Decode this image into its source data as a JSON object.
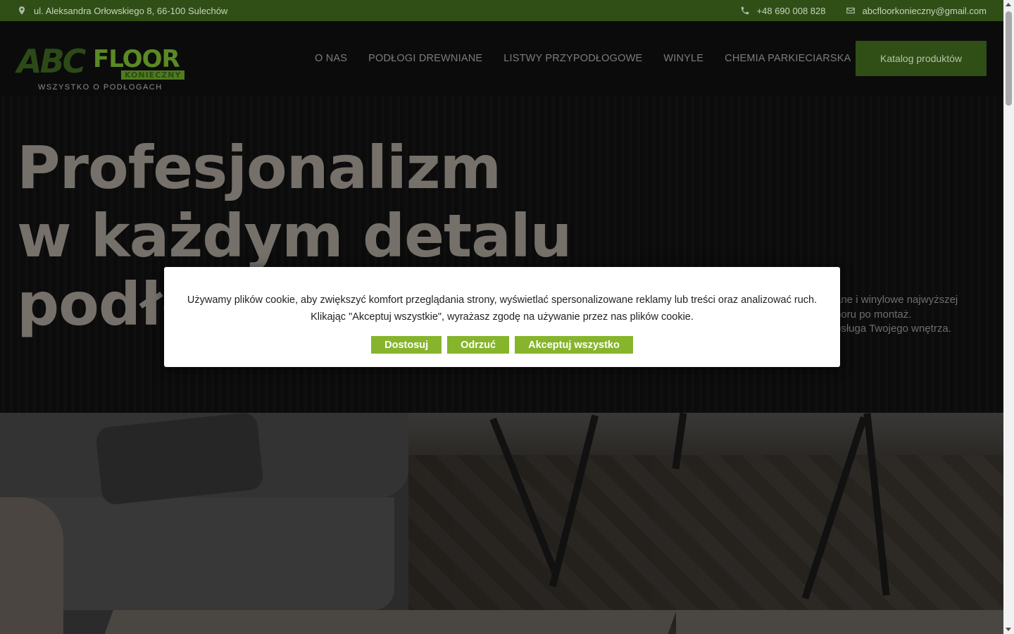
{
  "topbar": {
    "address": "ul. Aleksandra Orłowskiego 8, 66-100 Sulechów",
    "phone": "+48 690 008 828",
    "email": "abcfloorkonieczny@gmail.com",
    "icons": [
      "location-pin-icon",
      "phone-icon",
      "envelope-icon"
    ]
  },
  "header": {
    "logo": {
      "abc": "ABC",
      "floor": "FLOOR",
      "konieczny": "KONIECZNY",
      "tagline": "WSZYSTKO O PODŁOGACH"
    },
    "nav": [
      {
        "label": "O NAS"
      },
      {
        "label": "PODŁOGI DREWNIANE"
      },
      {
        "label": "LISTWY PRZYPODŁOGOWE"
      },
      {
        "label": "WINYLE"
      },
      {
        "label": "CHEMIA PARKIECIARSKA"
      }
    ],
    "cta_label": "Katalog produktów"
  },
  "hero": {
    "title_lines": [
      "Profesjonalizm",
      "w każdym detalu",
      "podło"
    ],
    "description_lines": [
      "ane i winylowe najwyższej",
      "boru po montaż.",
      "bsługa Twojego wnętrza."
    ]
  },
  "cookie": {
    "text_line1": "Używamy plików cookie, aby zwiększyć komfort przeglądania strony, wyświetlać spersonalizowane reklamy lub treści oraz analizować ruch.",
    "text_line2": "Klikając \"Akceptuj wszystkie\", wyrażasz zgodę na używanie przez nas plików cookie.",
    "buttons": {
      "customize": "Dostosuj",
      "reject": "Odrzuć",
      "accept": "Akceptuj wszystko"
    },
    "button_color": "#86b52c"
  },
  "colors": {
    "brand_green": "#2f4f16",
    "accent_green": "#86b52c"
  }
}
